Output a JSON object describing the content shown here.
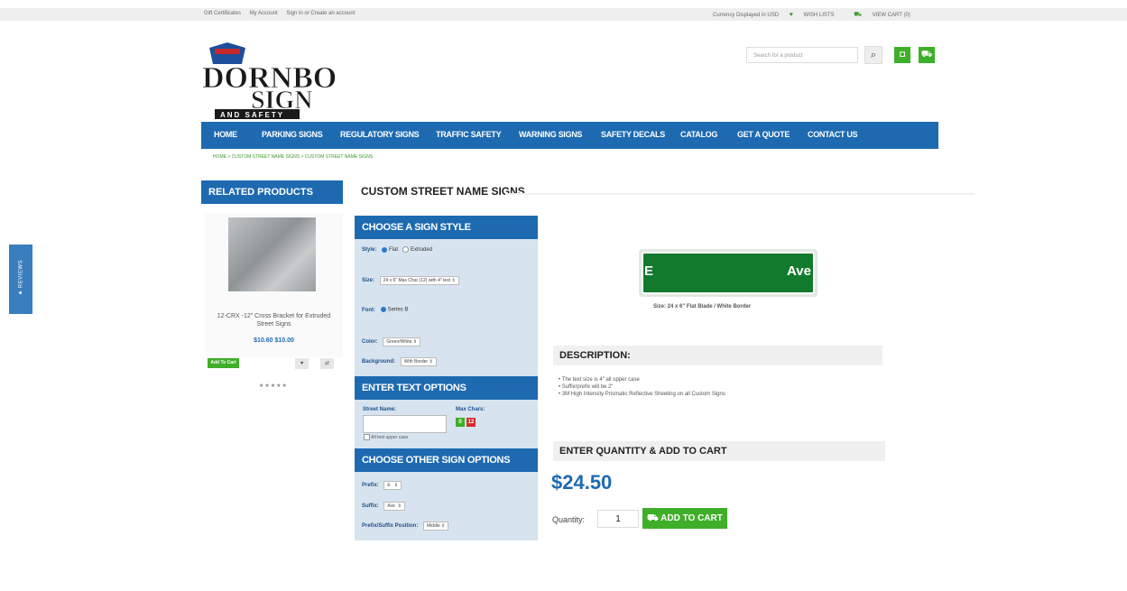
{
  "topbar": {
    "gift_certificates": "Gift Certificates",
    "my_account": "My Account",
    "sign_in": "Sign in or Create an account",
    "currency": "Currency Displayed in USD",
    "wish_lists": "WISH LISTS",
    "view_cart": "VIEW CART (0)"
  },
  "logo": {
    "line1": "DORNBOS",
    "line2": "SIGN",
    "line3": "AND SAFETY"
  },
  "search": {
    "placeholder": "Search for a product"
  },
  "nav": {
    "items": [
      "HOME",
      "PARKING SIGNS",
      "REGULATORY SIGNS",
      "TRAFFIC SAFETY",
      "WARNING SIGNS",
      "SAFETY DECALS",
      "CATALOG",
      "GET A QUOTE",
      "CONTACT US"
    ]
  },
  "breadcrumb": "HOME > CUSTOM STREET NAME SIGNS > CUSTOM STREET NAME SIGNS",
  "related": {
    "header": "RELATED PRODUCTS",
    "product_name": "12-CRX -12\" Cross Bracket for Extruded Street Signs",
    "price": "$10.60 $10.00",
    "add_to_cart": "Add To Cart",
    "stars": "★★★★★"
  },
  "page_title": "CUSTOM STREET NAME SIGNS",
  "options": {
    "style_header": "CHOOSE A SIGN STYLE",
    "style_label": "Style:",
    "style_flat": "Flat",
    "style_extruded": "Extruded",
    "size_label": "Size:",
    "size_value": "24 x 6\" Max Char (12) with 4\" text",
    "font_label": "Font:",
    "font_value": "Series B",
    "color_label": "Color:",
    "color_value": "Green/White",
    "background_label": "Background:",
    "background_value": "With Border",
    "text_header": "ENTER TEXT OPTIONS",
    "street_name_label": "Street Name:",
    "max_chars_label": "Max Chars:",
    "chars_used": "0",
    "chars_max": "12",
    "upper_case_note": "All text upper case",
    "other_header": "CHOOSE OTHER SIGN OPTIONS",
    "prefix_label": "Prefix:",
    "prefix_value": "E",
    "suffix_label": "Suffix:",
    "suffix_value": "Ave",
    "position_label": "Prefix/Suffix Position:",
    "position_value": "Middle"
  },
  "preview": {
    "prefix_text": "E",
    "suffix_text": "Ave",
    "caption": "Size: 24 x 6\" Flat Blade / White Border"
  },
  "description": {
    "header": "DESCRIPTION:",
    "items": [
      "The text size is 4\" all upper case",
      "Suffix/prefix will be 2\"",
      "3M High Intensity Prismatic Reflective Sheeting on all Custom Signs"
    ]
  },
  "purchase": {
    "header": "ENTER QUANTITY & ADD TO CART",
    "price": "$24.50",
    "quantity_label": "Quantity:",
    "quantity_value": "1",
    "add_to_cart": "ADD TO CART"
  },
  "reviews_tab": "★ REVIEWS",
  "colors": {
    "brand_blue": "#1d6ab1",
    "accent_green": "#3fae29",
    "sign_green": "#127a2c",
    "panel_bg": "#d7e4ef"
  }
}
